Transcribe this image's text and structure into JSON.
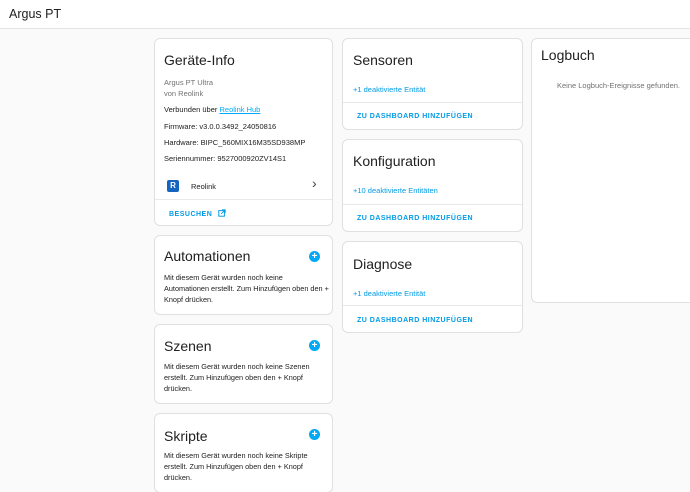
{
  "app": {
    "title": "Argus PT"
  },
  "device_info": {
    "title": "Geräte-Info",
    "model": "Argus PT Ultra",
    "manufacturer": "von Reolink",
    "connected_prefix": "Verbunden über",
    "connected_link": "Reolink Hub",
    "firmware": "Firmware: v3.0.0.3492_24050816",
    "hardware": "Hardware: BIPC_560MIX16M35SD938MP",
    "serial": "Seriennummer: 9527000920ZV14S1",
    "integration": "Reolink",
    "search_label": "BESUCHEN"
  },
  "automations": {
    "title": "Automationen",
    "text": "Mit diesem Gerät wurden noch keine Automationen erstellt. Zum Hinzufügen oben den + Knopf drücken."
  },
  "scenes": {
    "title": "Szenen",
    "text": "Mit diesem Gerät wurden noch keine Szenen erstellt. Zum Hinzufügen oben den + Knopf drücken."
  },
  "scripts": {
    "title": "Skripte",
    "text": "Mit diesem Gerät wurden noch keine Skripte erstellt. Zum Hinzufügen oben den + Knopf drücken."
  },
  "sensors": {
    "title": "Sensoren",
    "entities": "+1 deaktivierte Entität",
    "action": "ZU DASHBOARD HINZUFÜGEN"
  },
  "configuration": {
    "title": "Konfiguration",
    "entities": "+10 deaktivierte Entitäten",
    "action": "ZU DASHBOARD HINZUFÜGEN"
  },
  "diagnostics": {
    "title": "Diagnose",
    "entities": "+1 deaktivierte Entität",
    "action": "ZU DASHBOARD HINZUFÜGEN"
  },
  "logbook": {
    "title": "Logbuch",
    "empty": "Keine Logbuch-Ereignisse gefunden."
  },
  "icons": {
    "plus": "+",
    "chevron": "›",
    "external": "open-in-new-icon",
    "reolink_logo": "R"
  },
  "colors": {
    "accent": "#03a9f4",
    "link": "#039be5"
  }
}
